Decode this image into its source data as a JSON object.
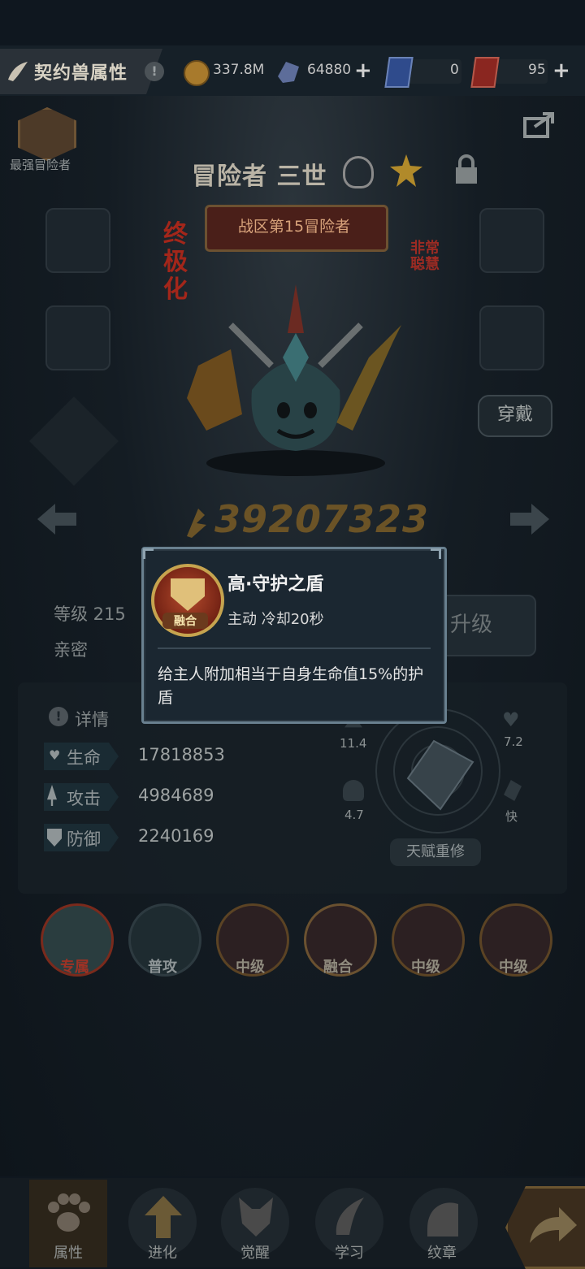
{
  "header": {
    "title": "契约兽属性",
    "gold": "337.8M",
    "crystal": "64880",
    "ticket_blue": "0",
    "ticket_red": "95"
  },
  "rank": {
    "label": "最强冒险者"
  },
  "pet": {
    "name": "冒险者 三世",
    "zone_banner": "战区第15冒险者",
    "tag_ultimate": "终极化",
    "tag_trait": "非常聪慧",
    "power": "39207323",
    "wear_label": "穿戴"
  },
  "info": {
    "level_label": "等级 215",
    "intimacy_label": "亲密",
    "upgrade_label": "升级",
    "details_label": "详情",
    "stats": [
      {
        "name": "生命",
        "value": "17818853"
      },
      {
        "name": "攻击",
        "value": "4984689"
      },
      {
        "name": "防御",
        "value": "2240169"
      }
    ],
    "radar": {
      "top_left": "11.4",
      "top_right": "7.2",
      "bottom_left": "4.7",
      "bottom_right": "快"
    },
    "reset_label": "天赋重修"
  },
  "skills": [
    {
      "label": "专属"
    },
    {
      "label": "普攻"
    },
    {
      "label": "中级"
    },
    {
      "label": "融合"
    },
    {
      "label": "中级"
    },
    {
      "label": "中级"
    }
  ],
  "popup": {
    "badge": "融合",
    "title": "高·守护之盾",
    "meta": "主动  冷却20秒",
    "description": "给主人附加相当于自身生命值15%的护盾"
  },
  "nav": [
    {
      "label": "属性"
    },
    {
      "label": "进化"
    },
    {
      "label": "觉醒"
    },
    {
      "label": "学习"
    },
    {
      "label": "纹章"
    }
  ]
}
